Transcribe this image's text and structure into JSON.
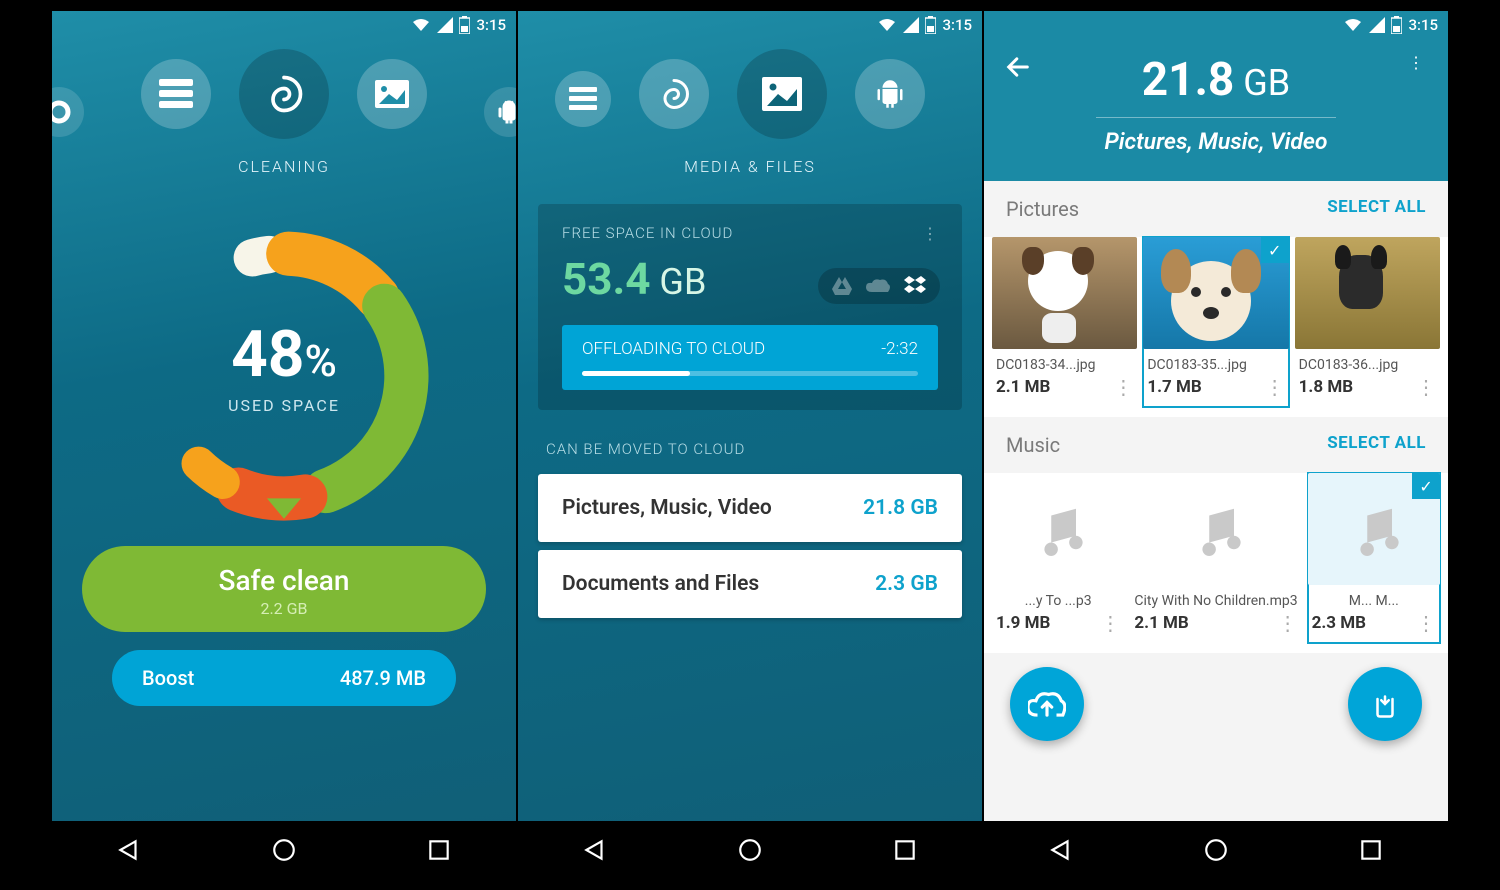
{
  "status": {
    "time": "3:15"
  },
  "screen1": {
    "tab_label": "CLEANING",
    "used_pct": "48",
    "used_pct_sym": "%",
    "used_label": "USED SPACE",
    "safe_clean_label": "Safe clean",
    "safe_clean_size": "2.2 GB",
    "boost_label": "Boost",
    "boost_size": "487.9 MB"
  },
  "chart_data": {
    "type": "pie",
    "title": "Used Space",
    "values_note": "donut segments by color, approximate arc percent of circle (not summing to 100, remaining is empty)",
    "segments": [
      {
        "name": "white-tick",
        "pct": 3,
        "color": "#f7f5e9"
      },
      {
        "name": "orange-1",
        "pct": 13,
        "color": "#f6a21c"
      },
      {
        "name": "green",
        "pct": 30,
        "color": "#7fb935"
      },
      {
        "name": "red-orange",
        "pct": 9,
        "color": "#ea5a25"
      },
      {
        "name": "orange-2",
        "pct": 4,
        "color": "#f6a21c"
      }
    ],
    "center_value": 48,
    "center_unit": "%",
    "center_label": "USED SPACE"
  },
  "screen2": {
    "tab_label": "MEDIA & FILES",
    "cloud_label": "FREE SPACE IN CLOUD",
    "cloud_free_value": "53.4",
    "cloud_free_unit": " GB",
    "offload_label": "OFFLOADING TO CLOUD",
    "offload_time": "-2:32",
    "offload_progress_pct": 32,
    "move_label": "CAN BE MOVED TO CLOUD",
    "rows": [
      {
        "name": "Pictures, Music, Video",
        "size": "21.8 GB"
      },
      {
        "name": "Documents and Files",
        "size": "2.3 GB"
      }
    ]
  },
  "screen3": {
    "size_value": "21.8",
    "size_unit": " GB",
    "subtitle": "Pictures, Music, Video",
    "select_all": "SELECT ALL",
    "sections": [
      {
        "title": "Pictures",
        "items": [
          {
            "name": "DC0183-34...jpg",
            "size": "2.1 MB",
            "selected": false
          },
          {
            "name": "DC0183-35...jpg",
            "size": "1.7 MB",
            "selected": true
          },
          {
            "name": "DC0183-36...jpg",
            "size": "1.8 MB",
            "selected": false
          }
        ]
      },
      {
        "title": "Music",
        "items": [
          {
            "name": "...y To ...p3",
            "size": "1.9 MB",
            "selected": false
          },
          {
            "name": "City With No Children.mp3",
            "size": "2.1 MB",
            "selected": false
          },
          {
            "name": "M... M...",
            "size": "2.3 MB",
            "selected": true
          }
        ]
      }
    ]
  }
}
